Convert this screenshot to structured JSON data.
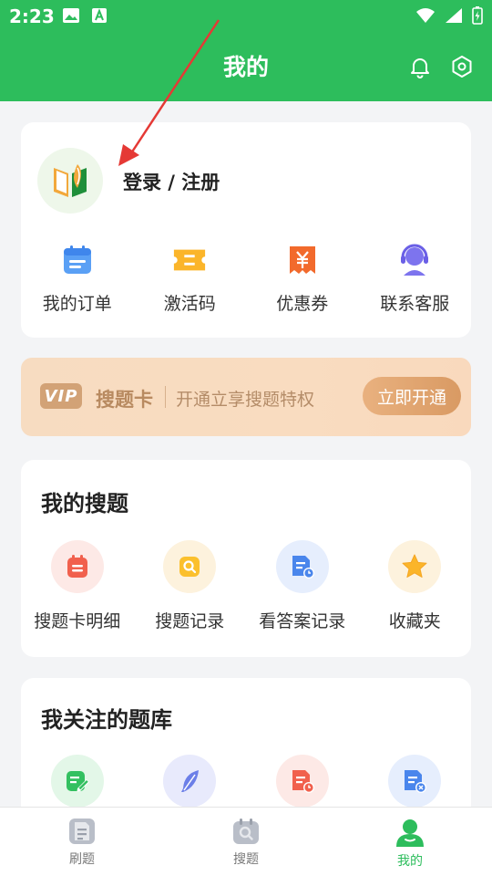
{
  "status": {
    "time": "2:23"
  },
  "header": {
    "title": "我的"
  },
  "profile": {
    "login_text": "登录 / 注册"
  },
  "quick_actions": [
    {
      "label": "我的订单",
      "icon": "calendar-list-icon"
    },
    {
      "label": "激活码",
      "icon": "ticket-code-icon"
    },
    {
      "label": "优惠券",
      "icon": "yen-coupon-icon"
    },
    {
      "label": "联系客服",
      "icon": "headset-icon"
    }
  ],
  "vip": {
    "badge": "VIP",
    "title": "搜题卡",
    "desc": "开通立享搜题特权",
    "button": "立即开通"
  },
  "my_search": {
    "title": "我的搜题",
    "items": [
      {
        "label": "搜题卡明细",
        "icon": "notepad-icon"
      },
      {
        "label": "搜题记录",
        "icon": "search-doc-icon"
      },
      {
        "label": "看答案记录",
        "icon": "doc-clock-icon"
      },
      {
        "label": "收藏夹",
        "icon": "star-icon"
      }
    ]
  },
  "followed": {
    "title": "我关注的题库",
    "items": [
      {
        "icon": "edit-note-icon"
      },
      {
        "icon": "feather-icon"
      },
      {
        "icon": "doc-clock-icon"
      },
      {
        "icon": "doc-cancel-icon"
      }
    ]
  },
  "tabbar": {
    "tabs": [
      {
        "label": "刷题",
        "icon": "doc-icon"
      },
      {
        "label": "搜题",
        "icon": "search-tab-icon"
      },
      {
        "label": "我的",
        "icon": "person-icon",
        "active": true
      }
    ]
  },
  "colors": {
    "brand": "#2dbd5c",
    "vip": "#d2a276"
  }
}
